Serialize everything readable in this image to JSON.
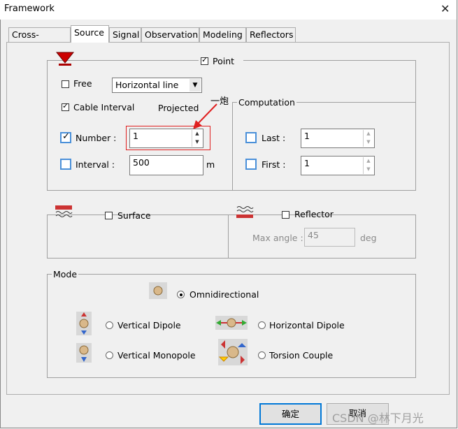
{
  "window": {
    "title": "Framework"
  },
  "tabs": [
    "Cross-section",
    "Source",
    "Signal",
    "Observation",
    "Modeling",
    "Reflectors"
  ],
  "source_group": {
    "point_label": "Point",
    "free_label": "Free",
    "placement_select": "Horizontal line",
    "cable_interval_label": "Cable Interval",
    "projected_label": "Projected",
    "annotation": "一炮",
    "number_label": "Number :",
    "number_value": "1",
    "interval_label": "Interval :",
    "interval_value": "500",
    "interval_unit": "m"
  },
  "computation": {
    "title": "Computation",
    "last_label": "Last :",
    "last_value": "1",
    "first_label": "First :",
    "first_value": "1"
  },
  "surface": {
    "label": "Surface"
  },
  "reflector": {
    "label": "Reflector",
    "max_angle_label": "Max angle :",
    "max_angle_value": "45",
    "unit": "deg"
  },
  "mode": {
    "title": "Mode",
    "omni": "Omnidirectional",
    "vdipole": "Vertical Dipole",
    "hdipole": "Horizontal Dipole",
    "vmonopole": "Vertical Monopole",
    "torsion": "Torsion Couple"
  },
  "buttons": {
    "ok": "确定",
    "cancel": "取消"
  },
  "watermark": "CSDN @林下月光",
  "colors": {
    "focus_blue": "#4a90d9",
    "annotation_red": "#e02020"
  }
}
